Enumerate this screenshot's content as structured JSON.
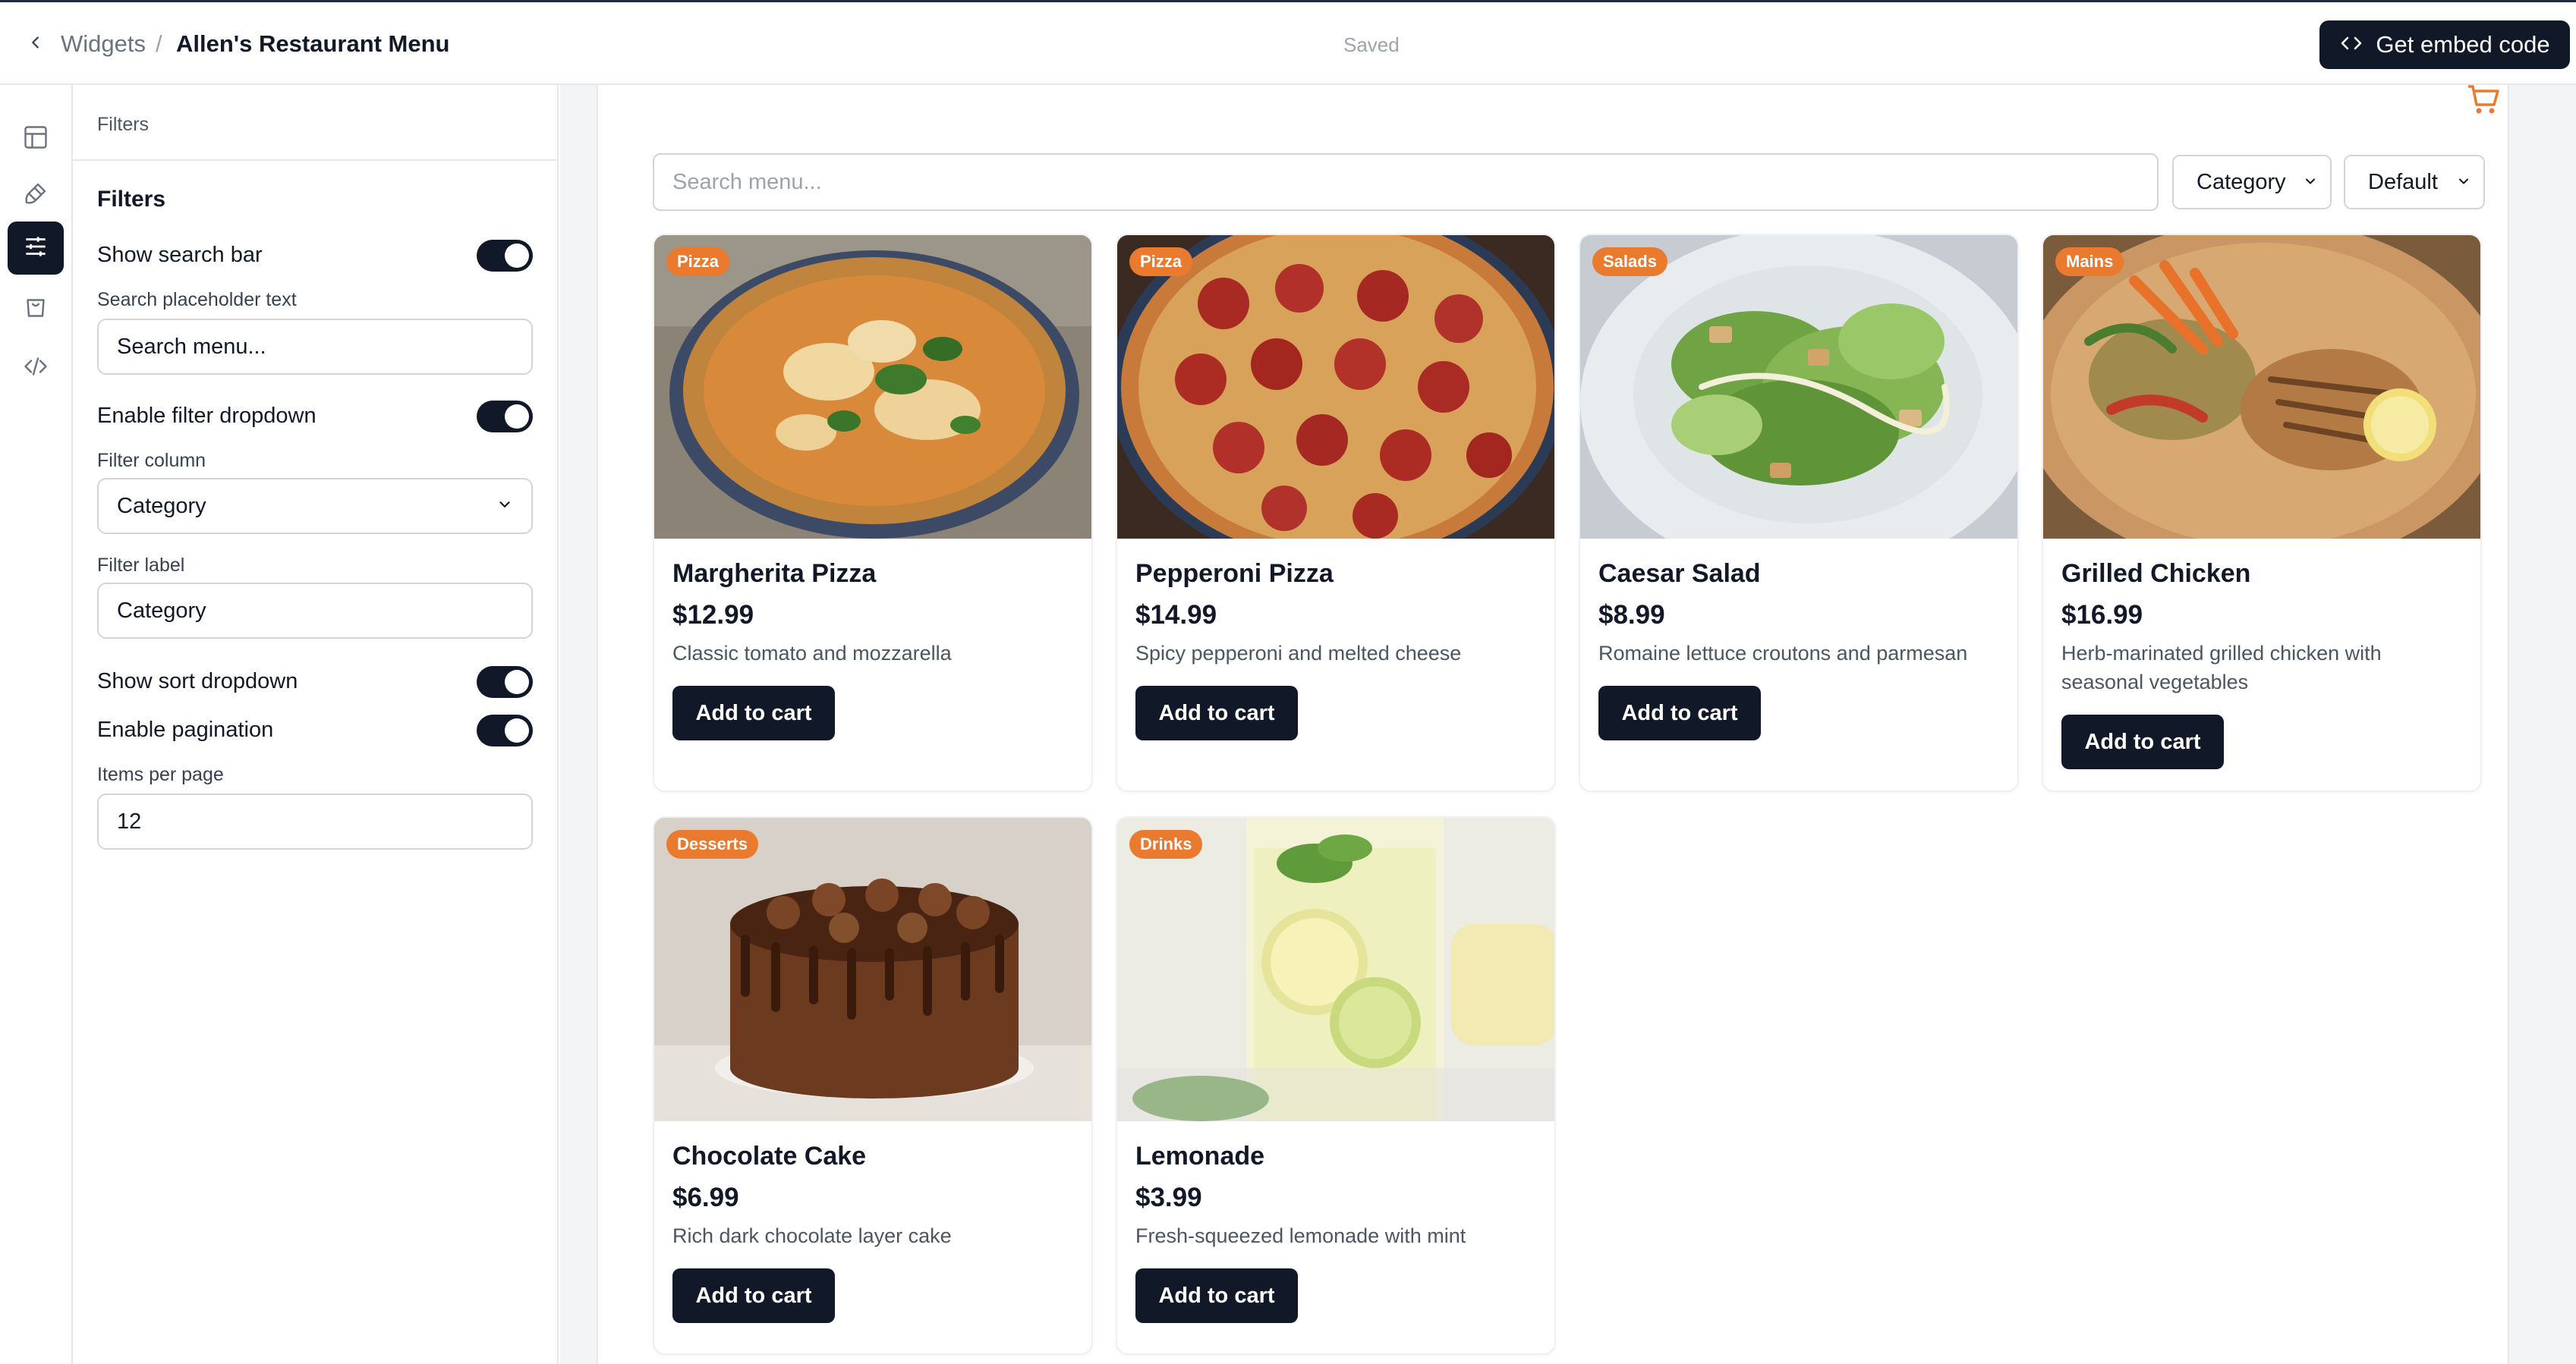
{
  "topbar": {
    "breadcrumb_parent": "Widgets",
    "breadcrumb_separator": "/",
    "title": "Allen's Restaurant Menu",
    "status": "Saved",
    "embed_button": "Get embed code"
  },
  "rail": {
    "items": [
      {
        "icon": "table-icon"
      },
      {
        "icon": "paintbrush-icon"
      },
      {
        "icon": "sliders-icon",
        "active": true
      },
      {
        "icon": "shopping-bag-icon"
      },
      {
        "icon": "code-icon"
      }
    ]
  },
  "panel": {
    "header": "Filters",
    "section_title": "Filters",
    "show_search_bar": {
      "label": "Show search bar",
      "enabled": true
    },
    "search_placeholder": {
      "label": "Search placeholder text",
      "value": "Search menu..."
    },
    "enable_filter_dropdown": {
      "label": "Enable filter dropdown",
      "enabled": true
    },
    "filter_column": {
      "label": "Filter column",
      "value": "Category"
    },
    "filter_label": {
      "label": "Filter label",
      "value": "Category"
    },
    "show_sort_dropdown": {
      "label": "Show sort dropdown",
      "enabled": true
    },
    "enable_pagination": {
      "label": "Enable pagination",
      "enabled": true
    },
    "items_per_page": {
      "label": "Items per page",
      "value": "12"
    }
  },
  "preview": {
    "search_placeholder": "Search menu...",
    "category_dropdown": "Category",
    "sort_dropdown": "Default",
    "accent_color": "#ea7a2e",
    "items": [
      {
        "name": "Margherita Pizza",
        "price": "$12.99",
        "desc": "Classic tomato and mozzarella",
        "category": "Pizza",
        "button": "Add to cart"
      },
      {
        "name": "Pepperoni Pizza",
        "price": "$14.99",
        "desc": "Spicy pepperoni and melted cheese",
        "category": "Pizza",
        "button": "Add to cart"
      },
      {
        "name": "Caesar Salad",
        "price": "$8.99",
        "desc": "Romaine lettuce croutons and parmesan",
        "category": "Salads",
        "button": "Add to cart"
      },
      {
        "name": "Grilled Chicken",
        "price": "$16.99",
        "desc": "Herb-marinated grilled chicken with seasonal vegetables",
        "category": "Mains",
        "button": "Add to cart"
      },
      {
        "name": "Chocolate Cake",
        "price": "$6.99",
        "desc": "Rich dark chocolate layer cake",
        "category": "Desserts",
        "button": "Add to cart"
      },
      {
        "name": "Lemonade",
        "price": "$3.99",
        "desc": "Fresh-squeezed lemonade with mint",
        "category": "Drinks",
        "button": "Add to cart"
      }
    ]
  }
}
